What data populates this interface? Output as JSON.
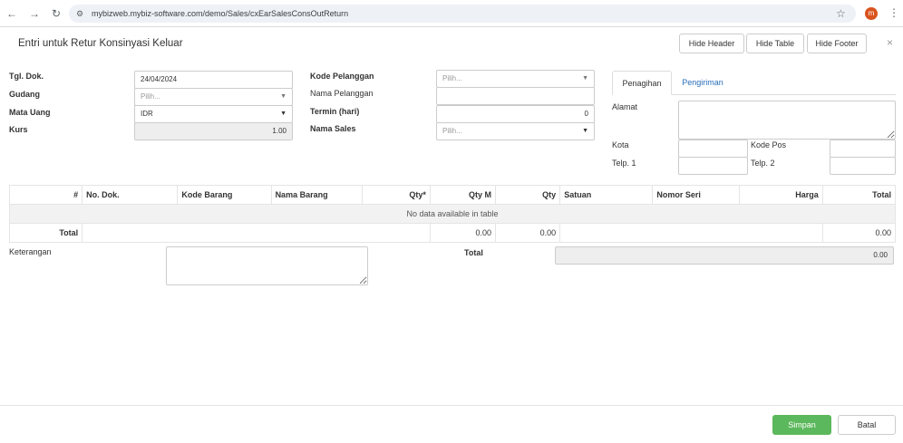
{
  "browser": {
    "url": "mybizweb.mybiz-software.com/demo/Sales/cxEarSalesConsOutReturn",
    "avatar_letter": "m"
  },
  "modal": {
    "title": "Entri untuk Retur Konsinyasi Keluar",
    "hide_header": "Hide Header",
    "hide_table": "Hide Table",
    "hide_footer": "Hide Footer",
    "close": "×"
  },
  "form": {
    "tgl_dok_label": "Tgl. Dok.",
    "tgl_dok_value": "24/04/2024",
    "gudang_label": "Gudang",
    "gudang_placeholder": "Pilih...",
    "mata_uang_label": "Mata Uang",
    "mata_uang_value": "IDR",
    "kurs_label": "Kurs",
    "kurs_value": "1.00",
    "kode_pelanggan_label": "Kode Pelanggan",
    "kode_pelanggan_placeholder": "Pilih...",
    "nama_pelanggan_label": "Nama Pelanggan",
    "termin_label": "Termin (hari)",
    "termin_value": "0",
    "nama_sales_label": "Nama Sales",
    "nama_sales_placeholder": "Pilih..."
  },
  "tabs": {
    "penagihan": "Penagihan",
    "pengiriman": "Pengiriman"
  },
  "address": {
    "alamat_label": "Alamat",
    "kota_label": "Kota",
    "kode_pos_label": "Kode Pos",
    "telp1_label": "Telp. 1",
    "telp2_label": "Telp. 2"
  },
  "table": {
    "columns": [
      "#",
      "No. Dok.",
      "Kode Barang",
      "Nama Barang",
      "Qty*",
      "Qty M",
      "Qty",
      "Satuan",
      "Nomor Seri",
      "Harga",
      "Total"
    ],
    "empty_message": "No data available in table",
    "footer_label": "Total",
    "footer_qty_m": "0.00",
    "footer_qty": "0.00",
    "footer_total": "0.00"
  },
  "bottom": {
    "keterangan_label": "Keterangan",
    "total_label": "Total",
    "total_value": "0.00"
  },
  "actions": {
    "save": "Simpan",
    "cancel": "Batal"
  }
}
